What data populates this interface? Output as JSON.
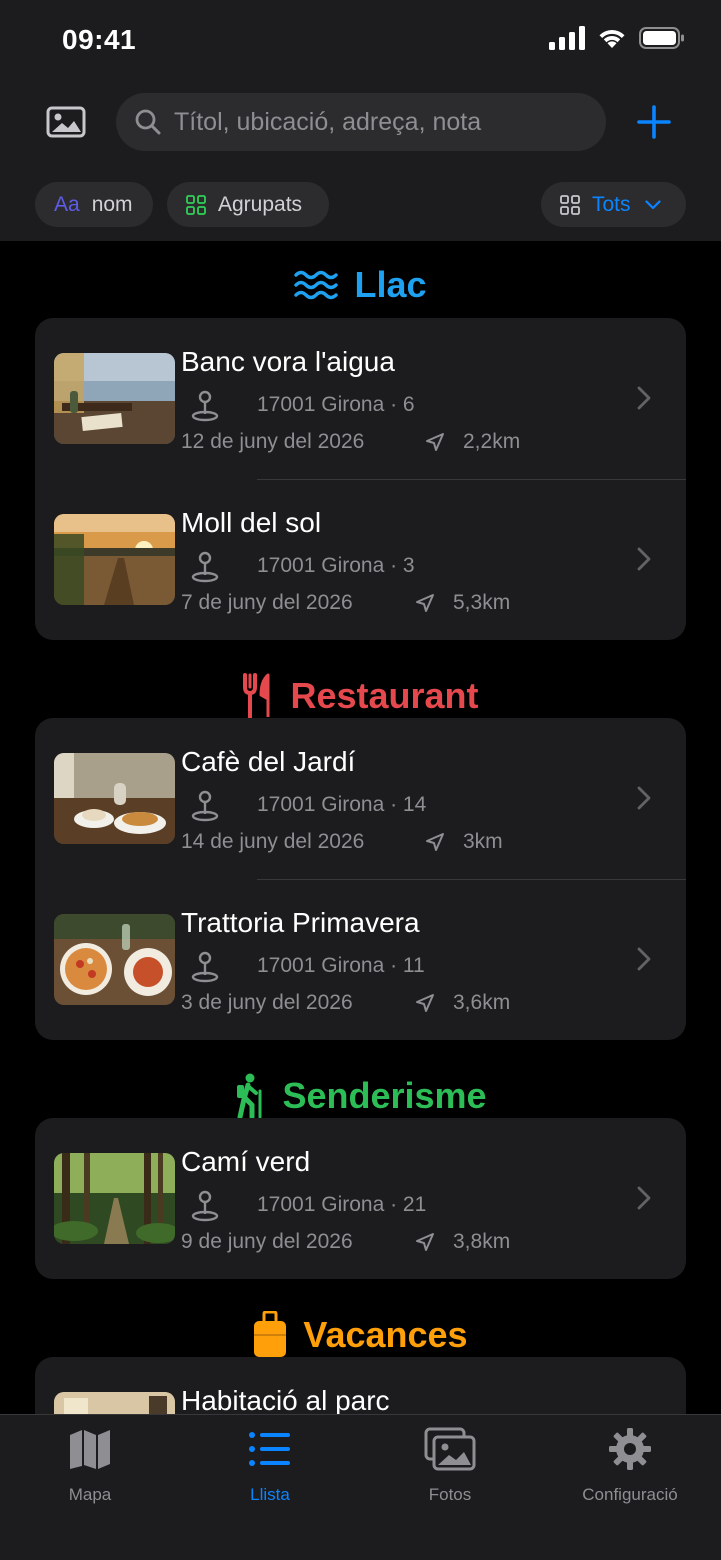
{
  "status": {
    "time": "09:41"
  },
  "search": {
    "placeholder": "Títol, ubicació, adreça, nota"
  },
  "chips": {
    "sort_prefix": "Aa",
    "sort_label": "nom",
    "group_label": "Agrupats",
    "filter_label": "Tots"
  },
  "sections": [
    {
      "title": "Llac",
      "icon": "water-waves-icon",
      "color": "#1ea1f1",
      "items": [
        {
          "title": "Banc vora l'aigua",
          "address": "17001 Girona · 6",
          "date": "12 de juny del 2026",
          "distance": "2,2km"
        },
        {
          "title": "Moll del sol",
          "address": "17001 Girona · 3",
          "date": "7 de juny del 2026",
          "distance": "5,3km"
        }
      ]
    },
    {
      "title": "Restaurant",
      "icon": "fork-knife-icon",
      "color": "#e5484d",
      "items": [
        {
          "title": "Cafè del Jardí",
          "address": "17001 Girona · 14",
          "date": "14 de juny del 2026",
          "distance": "3km"
        },
        {
          "title": "Trattoria Primavera",
          "address": "17001 Girona · 11",
          "date": "3 de juny del 2026",
          "distance": "3,6km"
        }
      ]
    },
    {
      "title": "Senderisme",
      "icon": "hiker-icon",
      "color": "#2dbd56",
      "items": [
        {
          "title": "Camí verd",
          "address": "17001 Girona · 21",
          "date": "9 de juny del 2026",
          "distance": "3,8km"
        }
      ]
    },
    {
      "title": "Vacances",
      "icon": "suitcase-icon",
      "color": "#ff9f0a",
      "items": [
        {
          "title": "Habitació al parc"
        }
      ]
    }
  ],
  "tabs": [
    {
      "label": "Mapa",
      "icon": "map-icon",
      "active": false
    },
    {
      "label": "Llista",
      "icon": "list-icon",
      "active": true
    },
    {
      "label": "Fotos",
      "icon": "photos-icon",
      "active": false
    },
    {
      "label": "Configuració",
      "icon": "gear-icon",
      "active": false
    }
  ],
  "colors": {
    "accent": "#0a84ff",
    "background": "#000000",
    "card": "#1c1c1e"
  }
}
